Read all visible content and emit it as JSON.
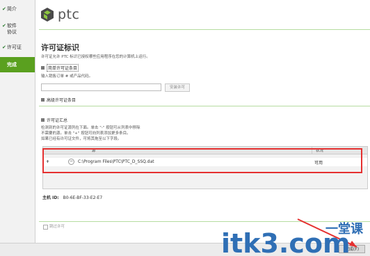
{
  "sidebar": {
    "items": [
      {
        "label": "简介",
        "checked": true
      },
      {
        "label": "软件\n协议",
        "checked": true
      },
      {
        "label": "许可证",
        "checked": true
      },
      {
        "label": "完成",
        "checked": false,
        "active": true
      }
    ]
  },
  "header": {
    "logo_text": "ptc"
  },
  "page": {
    "title": "许可证标识",
    "description": "许可证允许 PTC 标识已授权哪些应用程序在您的计算机上运行。"
  },
  "simple_license": {
    "section_label": "简单许可证条目",
    "prompt": "输入销售订单 # 或产品代码。",
    "input_value": "",
    "install_button": "安装许可"
  },
  "advanced_license": {
    "section_label": "高级许可证条目"
  },
  "summary": {
    "section_label": "许可证汇总",
    "lines": [
      "检测到的许可证源列在下面。单击 \"-\" 按钮可从列表中移除",
      "不需要的源。单击 \"+\" 按钮可向列表添加更多条目。",
      "如果已经有许可证文件，可将其拖至以下字段。"
    ],
    "columns": [
      "源",
      "状况"
    ],
    "rows": [
      {
        "add": "+",
        "remove": "−",
        "source": "C:\\Program Files\\PTC\\PTC_D_SSQ.dat",
        "status": "可用"
      }
    ]
  },
  "host": {
    "label": "主机 ID:",
    "value": "B0-6E-BF-33-E2-E7"
  },
  "skip": {
    "label": "跳过许可"
  },
  "footer": {
    "finish_button": "完成(F)"
  },
  "watermark": {
    "text": "itk3.com",
    "cn": "一堂课"
  },
  "colors": {
    "accent_green": "#5aa01f",
    "highlight_red": "#e53030",
    "watermark_blue": "#2f6fb5"
  }
}
